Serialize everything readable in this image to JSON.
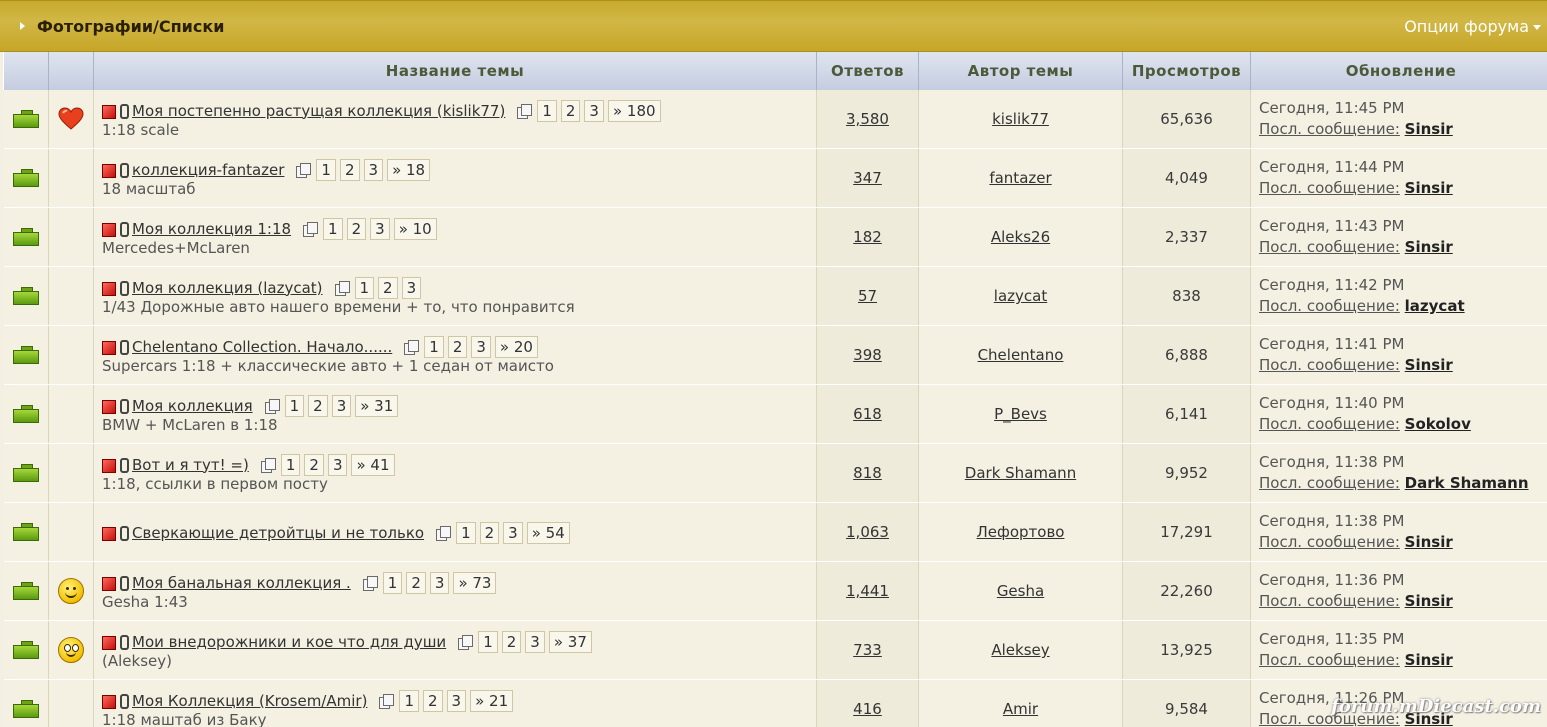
{
  "header": {
    "breadcrumb": "Фотографии/Списки",
    "options": "Опции форума"
  },
  "columns": {
    "title": "Название темы",
    "replies": "Ответов",
    "author": "Автор темы",
    "views": "Просмотров",
    "updated": "Обновление"
  },
  "last_post_label": "Посл. сообщение:",
  "watermark": "forum.mDiecast.com",
  "topics": [
    {
      "icon": "heart-icon",
      "title": "Моя постепенно растущая коллекция (kislik77)",
      "desc": "1:18 scale",
      "pages": [
        "1",
        "2",
        "3",
        "» 180"
      ],
      "replies": "3,580",
      "author": "kislik77",
      "views": "65,636",
      "date": "Сегодня, 11:45 PM",
      "last": "Sinsir"
    },
    {
      "icon": "",
      "title": "коллекция-fantazer",
      "desc": "18 масштаб",
      "pages": [
        "1",
        "2",
        "3",
        "» 18"
      ],
      "replies": "347",
      "author": "fantazer",
      "views": "4,049",
      "date": "Сегодня, 11:44 PM",
      "last": "Sinsir"
    },
    {
      "icon": "",
      "title": "Моя коллекция 1:18",
      "desc": "Mercedes+McLaren",
      "pages": [
        "1",
        "2",
        "3",
        "» 10"
      ],
      "replies": "182",
      "author": "Aleks26",
      "views": "2,337",
      "date": "Сегодня, 11:43 PM",
      "last": "Sinsir"
    },
    {
      "icon": "",
      "title": "Моя коллекция (lazycat)",
      "desc": "1/43 Дорожные авто нашего времени + то, что понравится",
      "pages": [
        "1",
        "2",
        "3"
      ],
      "replies": "57",
      "author": "lazycat",
      "views": "838",
      "date": "Сегодня, 11:42 PM",
      "last": "lazycat"
    },
    {
      "icon": "",
      "title": "Chelentano Collection. Начало......",
      "desc": "Supercars 1:18 + классические авто + 1 седан от маисто",
      "pages": [
        "1",
        "2",
        "3",
        "» 20"
      ],
      "replies": "398",
      "author": "Chelentano",
      "views": "6,888",
      "date": "Сегодня, 11:41 PM",
      "last": "Sinsir"
    },
    {
      "icon": "",
      "title": "Моя коллекция",
      "desc": "BMW + McLaren в 1:18",
      "pages": [
        "1",
        "2",
        "3",
        "» 31"
      ],
      "replies": "618",
      "author": "P_Bevs",
      "views": "6,141",
      "date": "Сегодня, 11:40 PM",
      "last": "Sokolov"
    },
    {
      "icon": "",
      "title": "Вот и я тут! =)",
      "desc": "1:18, ссылки в первом посту",
      "pages": [
        "1",
        "2",
        "3",
        "» 41"
      ],
      "replies": "818",
      "author": "Dark Shamann",
      "views": "9,952",
      "date": "Сегодня, 11:38 PM",
      "last": "Dark Shamann"
    },
    {
      "icon": "",
      "title": "Сверкающие детройтцы и не только",
      "desc": "",
      "pages": [
        "1",
        "2",
        "3",
        "» 54"
      ],
      "replies": "1,063",
      "author": "Лефортово",
      "views": "17,291",
      "date": "Сегодня, 11:38 PM",
      "last": "Sinsir"
    },
    {
      "icon": "smile-icon",
      "title": "Моя банальная коллекция .",
      "desc": "Gesha 1:43",
      "pages": [
        "1",
        "2",
        "3",
        "» 73"
      ],
      "replies": "1,441",
      "author": "Gesha",
      "views": "22,260",
      "date": "Сегодня, 11:36 PM",
      "last": "Sinsir"
    },
    {
      "icon": "grin-icon",
      "title": "Мои внедорожники и кое  что для души",
      "desc": "(Aleksey)",
      "pages": [
        "1",
        "2",
        "3",
        "» 37"
      ],
      "replies": "733",
      "author": "Aleksey",
      "views": "13,925",
      "date": "Сегодня, 11:35 PM",
      "last": "Sinsir"
    },
    {
      "icon": "",
      "title": "Моя Коллекция (Krosem/Amir)",
      "desc": "1:18 маштаб из Баку",
      "pages": [
        "1",
        "2",
        "3",
        "» 21"
      ],
      "replies": "416",
      "author": "Amir",
      "views": "9,584",
      "date": "Сегодня, 11:26 PM",
      "last": "Sinsir"
    }
  ]
}
